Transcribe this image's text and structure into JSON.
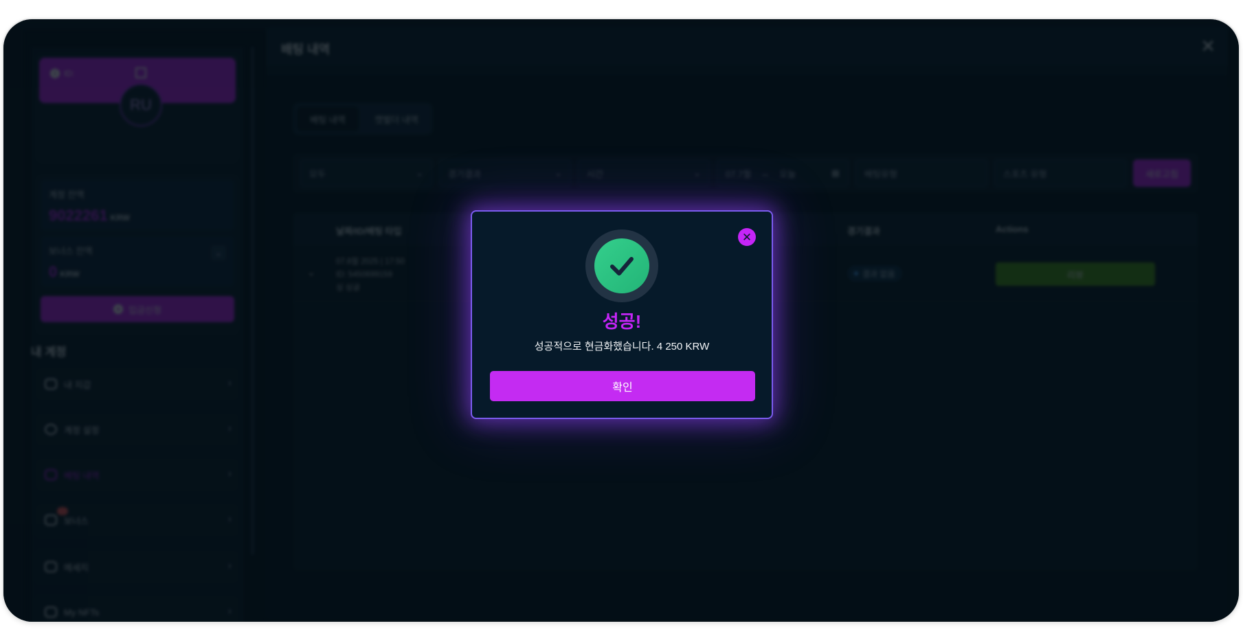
{
  "sidebar": {
    "id_label": "ID:",
    "avatar_initials": "RU",
    "account_balance_label": "계정 잔액",
    "account_balance_value": "9022261",
    "account_balance_unit": "KRW",
    "bonus_balance_label": "보너스 잔액",
    "bonus_balance_value": "0",
    "bonus_balance_unit": "KRW",
    "deposit_button": "입금신청",
    "section_title": "내 계정",
    "menu": [
      {
        "label": "내 지갑"
      },
      {
        "label": "계정 설정"
      },
      {
        "label": "베팅 내역"
      },
      {
        "label": "보너스"
      },
      {
        "label": "메세지"
      },
      {
        "label": "My NFTs"
      }
    ]
  },
  "panel": {
    "title": "배팅 내역",
    "tabs": [
      "배팅 내역",
      "캣벌더 내역"
    ],
    "filters": {
      "all": "모두",
      "result": "경기결과",
      "time": "시간",
      "date_from": "07.7월",
      "date_to": "오늘",
      "bet_type_placeholder": "배팅유형",
      "sport_type_placeholder": "스포츠 유형",
      "refresh_button": "새로고침"
    },
    "table": {
      "headers": [
        "날짜/ID/배팅 타입",
        "경기결과",
        "Actions"
      ],
      "rows": [
        {
          "date": "07.8월 2025 | 17:50",
          "id": "ID: 5450699159",
          "type": "싱 싱글",
          "status": "결과 없음",
          "action": "리뷰"
        }
      ]
    }
  },
  "modal": {
    "title": "성공!",
    "message": "성공적으로 현금화했습니다. 4 250 KRW",
    "confirm_button": "확인",
    "icons": {
      "status": "check-icon",
      "close": "close-icon"
    }
  },
  "colors": {
    "accent": "#c525f7",
    "success": "#2ec282",
    "modal_border": "#7c5cf0",
    "background": "#05111b"
  }
}
